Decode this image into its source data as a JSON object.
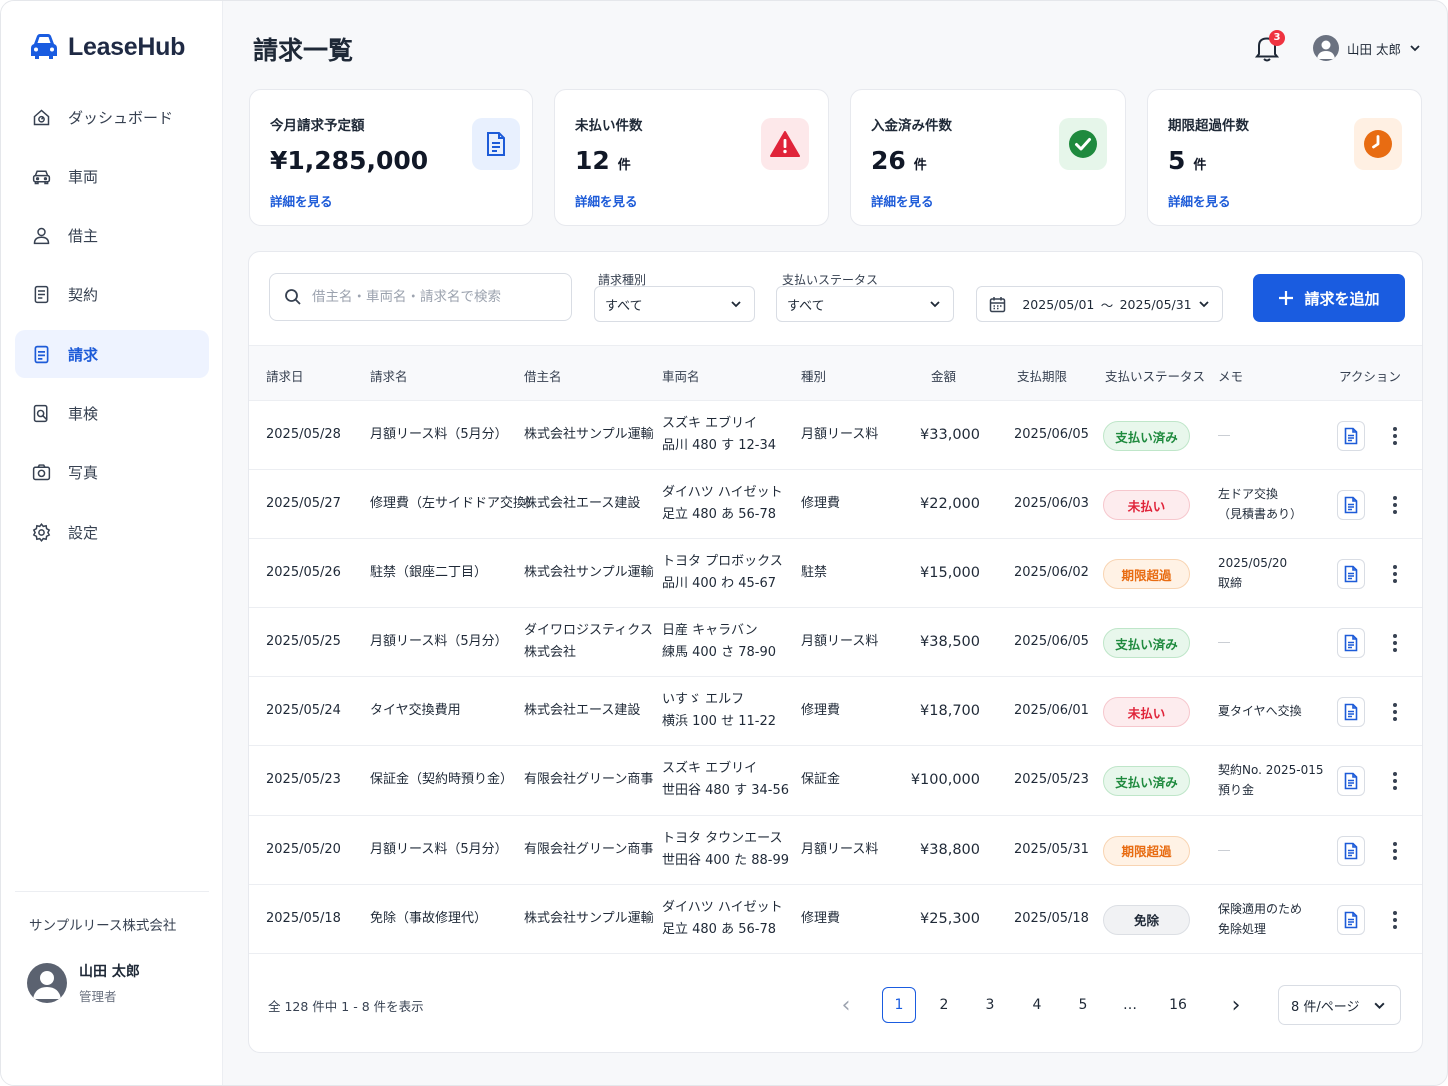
{
  "app": {
    "name": "LeaseHub"
  },
  "sidebar": {
    "items": [
      {
        "label": "ダッシュボード",
        "icon": "dashboard-icon",
        "active": false
      },
      {
        "label": "車両",
        "icon": "car-icon",
        "active": false
      },
      {
        "label": "借主",
        "icon": "person-icon",
        "active": false
      },
      {
        "label": "契約",
        "icon": "contract-icon",
        "active": false
      },
      {
        "label": "請求",
        "icon": "invoice-icon",
        "active": true
      },
      {
        "label": "車検",
        "icon": "inspection-icon",
        "active": false
      },
      {
        "label": "写真",
        "icon": "camera-icon",
        "active": false
      },
      {
        "label": "設定",
        "icon": "gear-icon",
        "active": false
      }
    ],
    "company": "サンプルリース株式会社",
    "profile": {
      "name": "山田 太郎",
      "role": "管理者"
    }
  },
  "header": {
    "title": "請求一覧",
    "notification_count": "3",
    "user_name": "山田 太郎"
  },
  "stats": [
    {
      "title": "今月請求予定額",
      "value": "¥1,285,000",
      "unit": "",
      "link": "詳細を見る",
      "icon": "document-icon",
      "accent": "#1d5bd8"
    },
    {
      "title": "未払い件数",
      "value": "12",
      "unit": "件",
      "link": "詳細を見る",
      "icon": "warning-icon",
      "accent": "#e0243a"
    },
    {
      "title": "入金済み件数",
      "value": "26",
      "unit": "件",
      "link": "詳細を見る",
      "icon": "check-icon",
      "accent": "#1f8a3e"
    },
    {
      "title": "期限超過件数",
      "value": "5",
      "unit": "件",
      "link": "詳細を見る",
      "icon": "clock-icon",
      "accent": "#e86c12"
    }
  ],
  "filters": {
    "search_placeholder": "借主名・車両名・請求名で検索",
    "type_label": "請求種別",
    "type_value": "すべて",
    "status_label": "支払いステータス",
    "status_value": "すべて",
    "date_from": "2025/05/01",
    "date_sep": "～",
    "date_to": "2025/05/31",
    "add_button": "請求を追加"
  },
  "table": {
    "headers": [
      "請求日",
      "請求名",
      "借主名",
      "車両名",
      "種別",
      "金額",
      "支払期限",
      "支払いステータス",
      "メモ",
      "アクション"
    ],
    "rows": [
      {
        "date": "2025/05/28",
        "name": "月額リース料（5月分）",
        "lessee": [
          "株式会社サンプル運輸"
        ],
        "vehicle": [
          "スズキ エブリイ",
          "品川 480 す 12-34"
        ],
        "type": "月額リース料",
        "amount": "¥33,000",
        "due": "2025/06/05",
        "status": "支払い済み",
        "status_kind": "paid",
        "memo": [
          "―"
        ]
      },
      {
        "date": "2025/05/27",
        "name": "修理費（左サイドドア交換）",
        "lessee": [
          "株式会社エース建設"
        ],
        "vehicle": [
          "ダイハツ ハイゼット",
          "足立 480 あ 56-78"
        ],
        "type": "修理費",
        "amount": "¥22,000",
        "due": "2025/06/03",
        "status": "未払い",
        "status_kind": "unpaid",
        "memo": [
          "左ドア交換",
          "（見積書あり）"
        ]
      },
      {
        "date": "2025/05/26",
        "name": "駐禁（銀座二丁目）",
        "lessee": [
          "株式会社サンプル運輸"
        ],
        "vehicle": [
          "トヨタ プロボックス",
          "品川 400 わ 45-67"
        ],
        "type": "駐禁",
        "amount": "¥15,000",
        "due": "2025/06/02",
        "status": "期限超過",
        "status_kind": "overdue",
        "memo": [
          "2025/05/20",
          "取締"
        ]
      },
      {
        "date": "2025/05/25",
        "name": "月額リース料（5月分）",
        "lessee": [
          "ダイワロジスティクス",
          "株式会社"
        ],
        "vehicle": [
          "日産 キャラバン",
          "練馬 400 さ 78-90"
        ],
        "type": "月額リース料",
        "amount": "¥38,500",
        "due": "2025/06/05",
        "status": "支払い済み",
        "status_kind": "paid",
        "memo": [
          "―"
        ]
      },
      {
        "date": "2025/05/24",
        "name": "タイヤ交換費用",
        "lessee": [
          "株式会社エース建設"
        ],
        "vehicle": [
          "いすゞ エルフ",
          "横浜 100 せ 11-22"
        ],
        "type": "修理費",
        "amount": "¥18,700",
        "due": "2025/06/01",
        "status": "未払い",
        "status_kind": "unpaid",
        "memo": [
          "夏タイヤへ交換"
        ]
      },
      {
        "date": "2025/05/23",
        "name": "保証金（契約時預り金）",
        "lessee": [
          "有限会社グリーン商事"
        ],
        "vehicle": [
          "スズキ エブリイ",
          "世田谷 480 す 34-56"
        ],
        "type": "保証金",
        "amount": "¥100,000",
        "due": "2025/05/23",
        "status": "支払い済み",
        "status_kind": "paid",
        "memo": [
          "契約No. 2025-015",
          "預り金"
        ]
      },
      {
        "date": "2025/05/20",
        "name": "月額リース料（5月分）",
        "lessee": [
          "有限会社グリーン商事"
        ],
        "vehicle": [
          "トヨタ タウンエース",
          "世田谷 400 た 88-99"
        ],
        "type": "月額リース料",
        "amount": "¥38,800",
        "due": "2025/05/31",
        "status": "期限超過",
        "status_kind": "overdue",
        "memo": [
          "―"
        ]
      },
      {
        "date": "2025/05/18",
        "name": "免除（事故修理代）",
        "lessee": [
          "株式会社サンプル運輸"
        ],
        "vehicle": [
          "ダイハツ ハイゼット",
          "足立 480 あ 56-78"
        ],
        "type": "修理費",
        "amount": "¥25,300",
        "due": "2025/05/18",
        "status": "免除",
        "status_kind": "exempt",
        "memo": [
          "保険適用のため",
          "免除処理"
        ]
      }
    ]
  },
  "pagination": {
    "summary": "全 128 件中 1 - 8 件を表示",
    "prev": "‹",
    "next": "›",
    "pages": [
      "1",
      "2",
      "3",
      "4",
      "5",
      "…",
      "16"
    ],
    "current": "1",
    "per_page": "8 件/ページ"
  },
  "colors": {
    "accent": "#1a5ce0",
    "paid": "#1f8a3e",
    "unpaid": "#e0243a",
    "overdue": "#e86c12"
  }
}
